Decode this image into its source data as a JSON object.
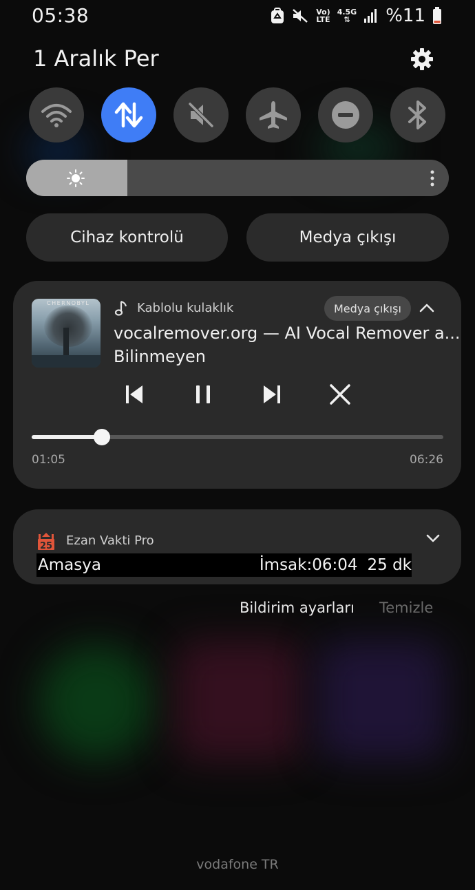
{
  "status_bar": {
    "time": "05:38",
    "network_top": "Vo)",
    "network_bottom": "LTE",
    "data_type": "4.5G",
    "battery": "%11",
    "battery_color": "#e0553a"
  },
  "header": {
    "date": "1 Aralık Per"
  },
  "quick_settings": [
    {
      "name": "wifi",
      "icon": "wifi-icon",
      "active": false
    },
    {
      "name": "mobile-data",
      "icon": "data-arrows-icon",
      "active": true
    },
    {
      "name": "sound",
      "icon": "mute-icon",
      "active": false
    },
    {
      "name": "airplane",
      "icon": "airplane-icon",
      "active": false
    },
    {
      "name": "do-not-disturb",
      "icon": "minus-circle-icon",
      "active": false
    },
    {
      "name": "bluetooth",
      "icon": "bluetooth-icon",
      "active": false
    }
  ],
  "brightness": {
    "level": 0.24
  },
  "shortcuts": {
    "device_control": "Cihaz kontrolü",
    "media_output": "Medya çıkışı"
  },
  "media": {
    "art_text": "CHERNOBYL",
    "device": "Kablolu kulaklık",
    "output_chip": "Medya çıkışı",
    "track": "vocalremover.org — AI Vocal Remover a...",
    "artist": "Bilinmeyen",
    "current_time": "01:05",
    "total_time": "06:26",
    "progress": 0.17
  },
  "ezan": {
    "icon_day": "25",
    "app_name": "Ezan Vakti Pro",
    "city": "Amasya",
    "prayer": "İmsak:06:04",
    "remaining": "25 dk"
  },
  "footer": {
    "notification_settings": "Bildirim ayarları",
    "clear": "Temizle",
    "carrier": "vodafone TR"
  },
  "colors": {
    "accent": "#3f7df6",
    "card": "#2a2a2a",
    "background": "#0b0b0b"
  }
}
